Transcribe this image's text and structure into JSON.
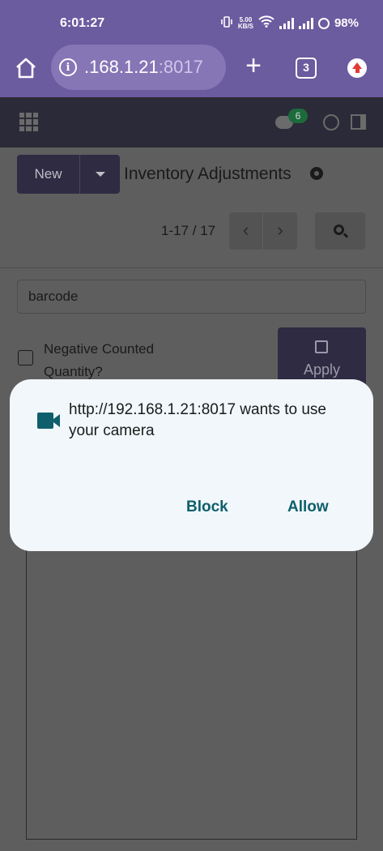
{
  "status_bar": {
    "time": "6:01:27",
    "speed_value": "5.00",
    "speed_unit": "KB/S",
    "battery": "98%"
  },
  "browser": {
    "url_host": ".168.1.21",
    "url_port": ":8017",
    "tab_count": "3",
    "info_glyph": "i",
    "plus_glyph": "+"
  },
  "odoo": {
    "chat_badge": "6",
    "new_label": "New",
    "page_title": "Inventory Adjustments",
    "pager_text": "1-17 / 17",
    "prev_glyph": "‹",
    "next_glyph": "›",
    "barcode_value": "barcode",
    "negative_label": "Negative Counted Quantity?",
    "apply_label": "Apply"
  },
  "dialog": {
    "message": "http://192.168.1.21:8017 wants to use your camera",
    "block_label": "Block",
    "allow_label": "Allow"
  },
  "colors": {
    "browser_bar": "#6b5b9f",
    "dialog_bg": "#f1f7fb",
    "dialog_button": "#0e5f6b"
  }
}
